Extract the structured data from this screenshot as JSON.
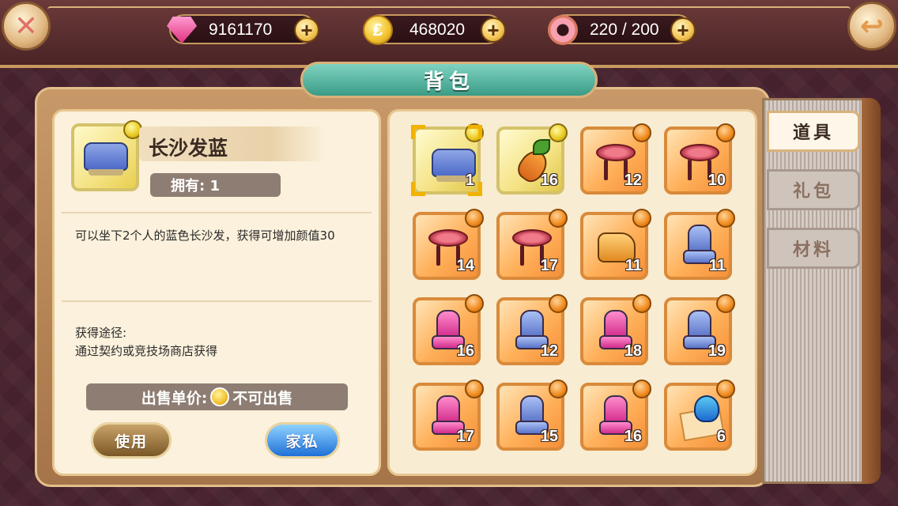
{
  "currencies": {
    "gems": {
      "value": "9161170",
      "icon": "gem-icon"
    },
    "coins": {
      "value": "468020",
      "icon": "coin-icon",
      "glyph": "₤"
    },
    "stamina": {
      "value": "220 / 200",
      "icon": "donut-icon"
    }
  },
  "header": {
    "title": "背包",
    "close_glyph": "✕",
    "back_glyph": "↩"
  },
  "plus_glyph": "+",
  "detail": {
    "name": "长沙发蓝",
    "owned": "拥有: 1",
    "description": "可以坐下2个人的蓝色长沙发，获得可增加颜值30",
    "source_title": "获得途径:",
    "source_text": "通过契约或竞技场商店获得",
    "sell_label": "出售单价:",
    "sell_value": "不可出售",
    "use_button": "使用",
    "furniture_button": "家私"
  },
  "tabs": [
    {
      "label": "道具",
      "active": true
    },
    {
      "label": "礼包",
      "active": false
    },
    {
      "label": "材料",
      "active": false
    }
  ],
  "inventory": [
    {
      "item": "blue-sofa",
      "count": "1",
      "quality": "yellow",
      "selected": true
    },
    {
      "item": "carrot",
      "count": "16",
      "quality": "yellow"
    },
    {
      "item": "red-stool",
      "count": "12",
      "quality": "orange"
    },
    {
      "item": "red-stool",
      "count": "10",
      "quality": "orange"
    },
    {
      "item": "red-stool",
      "count": "14",
      "quality": "orange"
    },
    {
      "item": "red-stool",
      "count": "17",
      "quality": "orange"
    },
    {
      "item": "yellow-sofa",
      "count": "11",
      "quality": "orange"
    },
    {
      "item": "blue-chair",
      "count": "11",
      "quality": "orange"
    },
    {
      "item": "pink-chair",
      "count": "16",
      "quality": "orange"
    },
    {
      "item": "blue-chair",
      "count": "12",
      "quality": "orange"
    },
    {
      "item": "pink-chair",
      "count": "18",
      "quality": "orange"
    },
    {
      "item": "blue-chair",
      "count": "19",
      "quality": "orange"
    },
    {
      "item": "pink-chair",
      "count": "17",
      "quality": "orange"
    },
    {
      "item": "blue-chair",
      "count": "15",
      "quality": "orange"
    },
    {
      "item": "pink-chair",
      "count": "16",
      "quality": "orange"
    },
    {
      "item": "character-card",
      "count": "6",
      "quality": "orange"
    }
  ]
}
